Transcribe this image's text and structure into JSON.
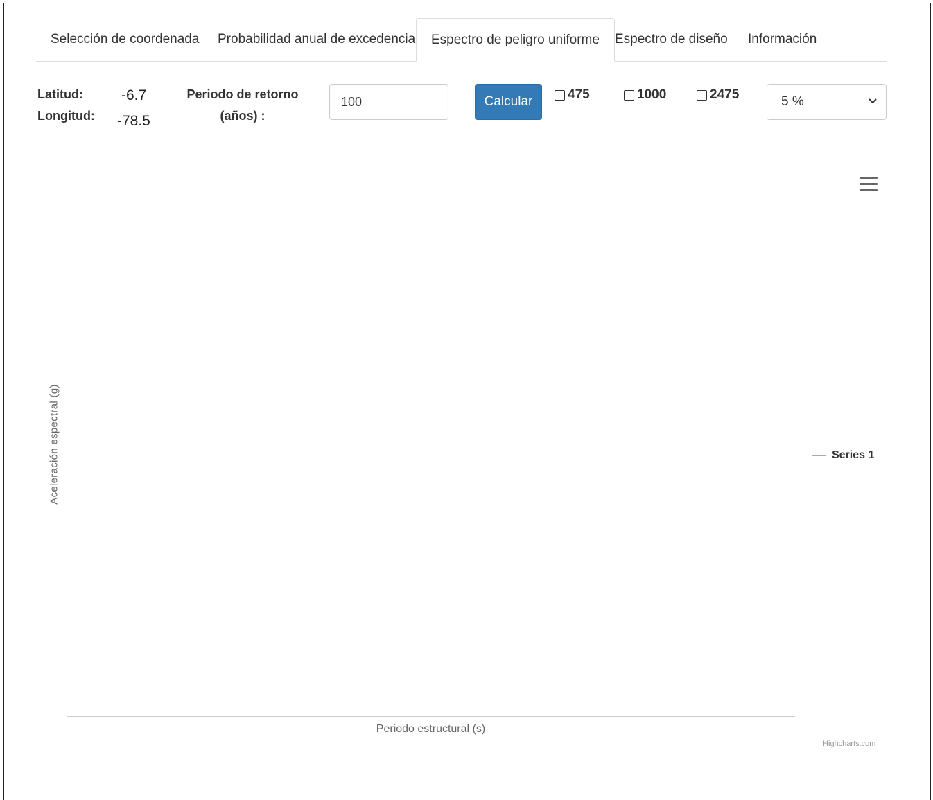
{
  "tabs": [
    {
      "label": "Selección de coordenada"
    },
    {
      "label": "Probabilidad anual de excedencia"
    },
    {
      "label": "Espectro de peligro uniforme",
      "active": true
    },
    {
      "label": "Espectro de diseño"
    },
    {
      "label": "Información"
    }
  ],
  "coords": {
    "lat_label": "Latitud:",
    "lat_value": "-6.7",
    "lon_label": "Longitud:",
    "lon_value": "-78.5"
  },
  "return_period": {
    "label_line1": "Periodo de retorno",
    "label_line2": "(años) :",
    "value": "100"
  },
  "calculate_label": "Calcular",
  "checkboxes": [
    {
      "label": "475",
      "checked": false
    },
    {
      "label": "1000",
      "checked": false
    },
    {
      "label": "2475",
      "checked": false
    }
  ],
  "damping_select": {
    "selected": "5 %"
  },
  "chart_data": {
    "type": "line",
    "xlabel": "Periodo estructural (s)",
    "ylabel": "Aceleración espectral (g)",
    "series": [
      {
        "name": "Series 1",
        "values": []
      }
    ],
    "legend": "right",
    "credits": "Highcharts.com",
    "colors": {
      "series": "#7cb5ec"
    }
  },
  "icons": {
    "menu": "hamburger-menu-icon",
    "select_arrow": "chevron-down-icon"
  },
  "colors": {
    "primary_button": "#337ab7"
  }
}
